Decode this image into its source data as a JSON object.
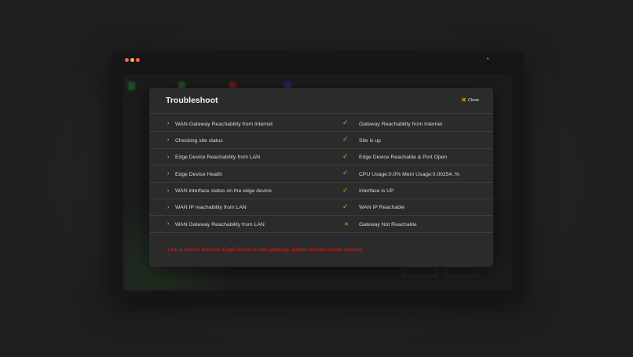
{
  "modal": {
    "title": "Troubleshoot",
    "close_label": "Close",
    "checks": [
      {
        "name": "WAN-Gateway Reachability from Internet",
        "status": "ok",
        "result": "Gateway Reachability from Internet"
      },
      {
        "name": "Checking site status",
        "status": "ok",
        "result": "Site is up"
      },
      {
        "name": "Edge Device Reachability from LAN",
        "status": "ok",
        "result": "Edge Device Reachable & Port Open"
      },
      {
        "name": "Edge Device Health",
        "status": "ok",
        "result": "CPU Usage:0.0% Mem Usage:0.00254..%"
      },
      {
        "name": "WAN interface status on the edge device",
        "status": "ok",
        "result": "Interface is UP"
      },
      {
        "name": "WAN IP reachability from LAN",
        "status": "ok",
        "result": "WAN IP Reachable"
      },
      {
        "name": "WAN Gateway Reachability from LAN",
        "status": "fail",
        "result": "Gateway Not Reachable"
      }
    ],
    "error_message": "Link is broken between Edge Device to wan gateway, please contact service provider"
  },
  "icons": {
    "check": "checkmark-icon",
    "fail": "cross-icon",
    "chevron": "chevron-right-icon"
  },
  "colors": {
    "accent": "#f0a500",
    "error": "#e01b1b",
    "modal_bg": "#2b2b2b"
  }
}
